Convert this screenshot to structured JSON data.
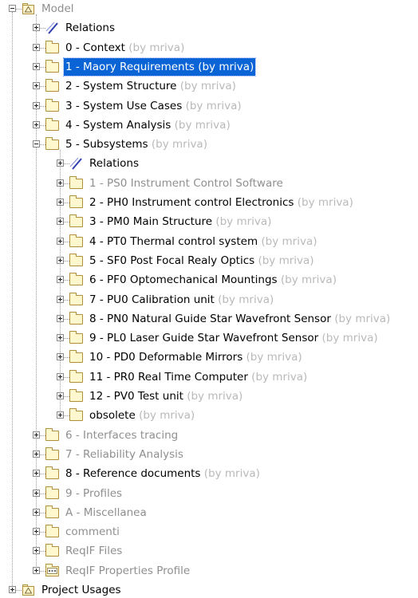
{
  "tree": {
    "rows": [
      {
        "label": "Model",
        "by": "",
        "icon": "model-package-icon",
        "level": 0,
        "expanded": true,
        "gray": true,
        "selected": false
      },
      {
        "label": "Relations",
        "by": "",
        "icon": "relations-icon",
        "level": 1,
        "expanded": false,
        "gray": false,
        "selected": false
      },
      {
        "label": "0 - Context",
        "by": "(by mriva)",
        "icon": "package-folder-icon",
        "level": 1,
        "expanded": false,
        "gray": false,
        "selected": false
      },
      {
        "label": "1 - Maory Requirements (by mriva)",
        "by": "",
        "icon": "package-folder-icon",
        "level": 1,
        "expanded": false,
        "gray": false,
        "selected": true
      },
      {
        "label": "2  - System Structure",
        "by": "(by mriva)",
        "icon": "package-folder-icon",
        "level": 1,
        "expanded": false,
        "gray": false,
        "selected": false
      },
      {
        "label": "3 - System Use Cases",
        "by": "(by mriva)",
        "icon": "package-folder-icon",
        "level": 1,
        "expanded": false,
        "gray": false,
        "selected": false
      },
      {
        "label": "4 - System Analysis",
        "by": "(by mriva)",
        "icon": "package-folder-icon",
        "level": 1,
        "expanded": false,
        "gray": false,
        "selected": false
      },
      {
        "label": "5 - Subsystems",
        "by": "(by mriva)",
        "icon": "package-folder-icon",
        "level": 1,
        "expanded": true,
        "gray": false,
        "selected": false
      },
      {
        "label": "Relations",
        "by": "",
        "icon": "relations-icon",
        "level": 2,
        "expanded": false,
        "gray": false,
        "selected": false
      },
      {
        "label": "1 - PS0 Instrument Control Software",
        "by": "",
        "icon": "package-folder-icon",
        "level": 2,
        "expanded": false,
        "gray": true,
        "selected": false
      },
      {
        "label": "2 - PH0 Instrument control Electronics",
        "by": "(by mriva)",
        "icon": "package-folder-icon",
        "level": 2,
        "expanded": false,
        "gray": false,
        "selected": false
      },
      {
        "label": "3 - PM0 Main Structure",
        "by": "(by mriva)",
        "icon": "package-folder-icon",
        "level": 2,
        "expanded": false,
        "gray": false,
        "selected": false
      },
      {
        "label": "4 - PT0 Thermal control system",
        "by": "(by mriva)",
        "icon": "package-folder-icon",
        "level": 2,
        "expanded": false,
        "gray": false,
        "selected": false
      },
      {
        "label": "5 - SF0 Post Focal Realy Optics",
        "by": "(by mriva)",
        "icon": "package-folder-icon",
        "level": 2,
        "expanded": false,
        "gray": false,
        "selected": false
      },
      {
        "label": "6 - PF0 Optomechanical Mountings",
        "by": "(by mriva)",
        "icon": "package-folder-icon",
        "level": 2,
        "expanded": false,
        "gray": false,
        "selected": false
      },
      {
        "label": "7 - PU0 Calibration unit",
        "by": "(by mriva)",
        "icon": "package-folder-icon",
        "level": 2,
        "expanded": false,
        "gray": false,
        "selected": false
      },
      {
        "label": "8 - PN0 Natural Guide Star Wavefront Sensor",
        "by": "(by mriva)",
        "icon": "package-folder-icon",
        "level": 2,
        "expanded": false,
        "gray": false,
        "selected": false
      },
      {
        "label": "9 - PL0 Laser Guide Star Wavefront Sensor",
        "by": "(by mriva)",
        "icon": "package-folder-icon",
        "level": 2,
        "expanded": false,
        "gray": false,
        "selected": false
      },
      {
        "label": "10 - PD0 Deformable Mirrors",
        "by": "(by mriva)",
        "icon": "package-folder-icon",
        "level": 2,
        "expanded": false,
        "gray": false,
        "selected": false
      },
      {
        "label": "11 - PR0 Real Time Computer",
        "by": "(by mriva)",
        "icon": "package-folder-icon",
        "level": 2,
        "expanded": false,
        "gray": false,
        "selected": false
      },
      {
        "label": "12 - PV0 Test unit",
        "by": "(by mriva)",
        "icon": "package-folder-icon",
        "level": 2,
        "expanded": false,
        "gray": false,
        "selected": false
      },
      {
        "label": "obsolete",
        "by": "(by mriva)",
        "icon": "package-folder-icon",
        "level": 2,
        "expanded": false,
        "gray": false,
        "selected": false
      },
      {
        "label": "6 - Interfaces tracing",
        "by": "",
        "icon": "package-folder-icon",
        "level": 1,
        "expanded": false,
        "gray": true,
        "selected": false
      },
      {
        "label": "7 - Reliability Analysis",
        "by": "",
        "icon": "package-folder-icon",
        "level": 1,
        "expanded": false,
        "gray": true,
        "selected": false
      },
      {
        "label": "8 - Reference documents",
        "by": "(by mriva)",
        "icon": "package-folder-icon",
        "level": 1,
        "expanded": false,
        "gray": false,
        "selected": false
      },
      {
        "label": "9 -  Profiles",
        "by": "",
        "icon": "package-folder-icon",
        "level": 1,
        "expanded": false,
        "gray": true,
        "selected": false
      },
      {
        "label": "A - Miscellanea",
        "by": "",
        "icon": "package-folder-icon",
        "level": 1,
        "expanded": false,
        "gray": true,
        "selected": false
      },
      {
        "label": "commenti",
        "by": "",
        "icon": "package-folder-icon",
        "level": 1,
        "expanded": false,
        "gray": true,
        "selected": false
      },
      {
        "label": "ReqIF Files",
        "by": "",
        "icon": "package-folder-icon",
        "level": 1,
        "expanded": false,
        "gray": true,
        "selected": false
      },
      {
        "label": "ReqIF Properties Profile",
        "by": "",
        "icon": "profile-folder-icon",
        "level": 1,
        "expanded": false,
        "gray": true,
        "selected": false
      },
      {
        "label": "Project Usages",
        "by": "",
        "icon": "model-package-icon",
        "level": 0,
        "expanded": false,
        "gray": false,
        "selected": false
      }
    ]
  },
  "colors": {
    "selection": "#0a64d6",
    "folder_border": "#b08f3a",
    "folder_fill": "#fff8cf",
    "gray_text": "#8f8f8f",
    "owner_text": "#b9b9b9"
  }
}
